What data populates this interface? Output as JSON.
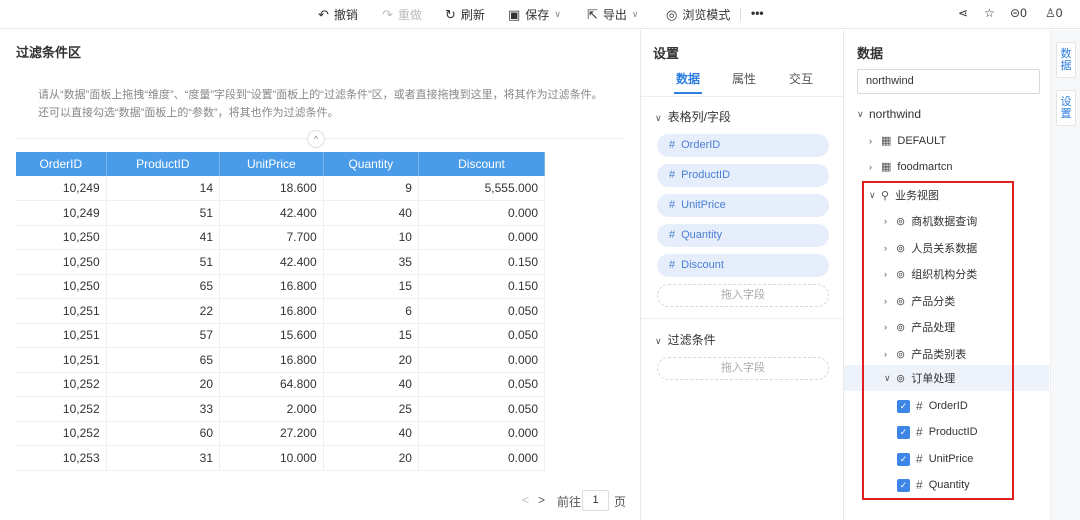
{
  "toolbar": {
    "undo": "撤销",
    "redo": "重做",
    "refresh": "刷新",
    "save": "保存",
    "export": "导出",
    "browse": "浏览模式",
    "more": "•••",
    "comments_count": "0",
    "likes_count": "0"
  },
  "left": {
    "title": "过滤条件区",
    "hint1": "请从“数据”面板上拖拽“维度”、“度量”字段到“设置”面板上的“过滤条件”区，或者直接拖拽到这里，将其作为过滤条件。",
    "hint2": "还可以直接勾选“数据”面板上的“参数”，将其也作为过滤条件。",
    "collapse_icon": "^",
    "columns": [
      "OrderID",
      "ProductID",
      "UnitPrice",
      "Quantity",
      "Discount"
    ],
    "rows": [
      [
        "10,249",
        "14",
        "18.600",
        "9",
        "5,555.000"
      ],
      [
        "10,249",
        "51",
        "42.400",
        "40",
        "0.000"
      ],
      [
        "10,250",
        "41",
        "7.700",
        "10",
        "0.000"
      ],
      [
        "10,250",
        "51",
        "42.400",
        "35",
        "0.150"
      ],
      [
        "10,250",
        "65",
        "16.800",
        "15",
        "0.150"
      ],
      [
        "10,251",
        "22",
        "16.800",
        "6",
        "0.050"
      ],
      [
        "10,251",
        "57",
        "15.600",
        "15",
        "0.050"
      ],
      [
        "10,251",
        "65",
        "16.800",
        "20",
        "0.000"
      ],
      [
        "10,252",
        "20",
        "64.800",
        "40",
        "0.050"
      ],
      [
        "10,252",
        "33",
        "2.000",
        "25",
        "0.050"
      ],
      [
        "10,252",
        "60",
        "27.200",
        "40",
        "0.000"
      ],
      [
        "10,253",
        "31",
        "10.000",
        "20",
        "0.000"
      ]
    ],
    "pager_prev": "<",
    "pager_next": ">",
    "pager_goto": "前往",
    "pager_page": "1",
    "pager_unit": "页"
  },
  "settings": {
    "title": "设置",
    "tabs": [
      "数据",
      "属性",
      "交互"
    ],
    "section1": "表格列/字段",
    "fields": [
      "OrderID",
      "ProductID",
      "UnitPrice",
      "Quantity",
      "Discount"
    ],
    "drop1": "拖入字段",
    "section2": "过滤条件",
    "drop2": "拖入字段"
  },
  "data_panel": {
    "title": "数据",
    "search_value": "northwind",
    "root": "northwind",
    "items": [
      {
        "label": "DEFAULT"
      },
      {
        "label": "foodmartcn"
      }
    ],
    "business_view": "业务视图",
    "views": [
      "商机数据查询",
      "人员关系数据",
      "组织机构分类",
      "产品分类",
      "产品处理",
      "产品类别表",
      "订单处理"
    ],
    "checked_fields": [
      "OrderID",
      "ProductID",
      "UnitPrice",
      "Quantity"
    ]
  },
  "side_tabs": [
    "数据",
    "设置"
  ]
}
